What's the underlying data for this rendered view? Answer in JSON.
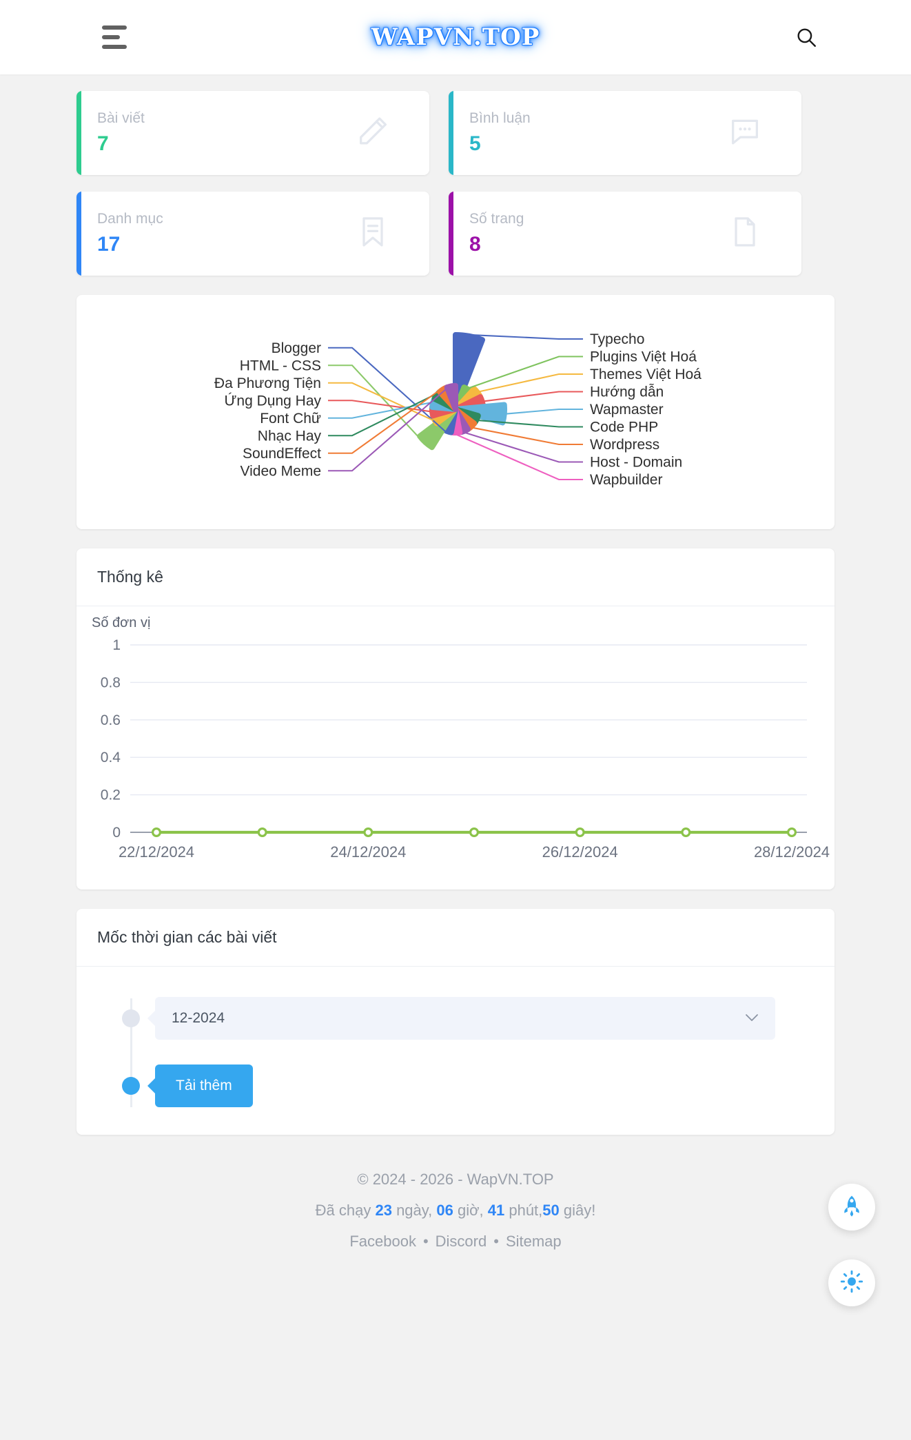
{
  "header": {
    "brand": "WAPVN.TOP",
    "menu_icon": "hamburger-icon",
    "search_icon": "search-icon"
  },
  "stats": [
    {
      "label": "Bài viết",
      "value": "7",
      "color": "#2ecc8f",
      "icon": "pencil-icon"
    },
    {
      "label": "Bình luận",
      "value": "5",
      "color": "#2ab7c8",
      "icon": "comment-icon"
    },
    {
      "label": "Danh mục",
      "value": "17",
      "color": "#2f86f6",
      "icon": "bookmark-icon"
    },
    {
      "label": "Số trang",
      "value": "8",
      "color": "#9c11a8",
      "icon": "page-icon"
    }
  ],
  "category_chart": {
    "type": "pie",
    "title": "",
    "labels": [
      "Typecho",
      "Plugins Việt Hoá",
      "Themes Việt Hoá",
      "Hướng dẫn",
      "Wapmaster",
      "Code PHP",
      "Wordpress",
      "Host - Domain",
      "Wapbuilder",
      "Blogger",
      "HTML - CSS",
      "Đa Phương Tiện",
      "Ứng Dụng Hay",
      "Font Chữ",
      "Nhạc Hay",
      "SoundEffect",
      "Video Meme"
    ],
    "values": [
      13,
      1,
      2,
      2,
      7,
      1,
      1,
      1,
      1,
      1,
      6,
      1,
      1,
      1,
      1,
      1,
      1
    ],
    "colors": [
      "#4a68c0",
      "#7fc35e",
      "#f5b940",
      "#e8595b",
      "#62b4dd",
      "#2f8a5f",
      "#f07b35",
      "#9b59b6",
      "#ee5fc0",
      "#4a68c0",
      "#8cc96a",
      "#f5b940",
      "#e8595b",
      "#62b4dd",
      "#2f8a5f",
      "#f07b35",
      "#9b59b6"
    ]
  },
  "stats_panel": {
    "title": "Thống kê"
  },
  "line_chart": {
    "type": "line",
    "ylabel": "Số đơn vị",
    "xlabel": "",
    "ylim": [
      0,
      1
    ],
    "yticks": [
      "1",
      "0.8",
      "0.6",
      "0.4",
      "0.2",
      "0"
    ],
    "xticks": [
      "22/12/2024",
      "24/12/2024",
      "26/12/2024",
      "28/12/2024"
    ],
    "x": [
      "22/12/2024",
      "23/12/2024",
      "24/12/2024",
      "25/12/2024",
      "26/12/2024",
      "27/12/2024",
      "28/12/2024"
    ],
    "values": [
      0,
      0,
      0,
      0,
      0,
      0,
      0
    ],
    "series_color": "#8bc34a",
    "grid": true,
    "legend": "none"
  },
  "timeline": {
    "title": "Mốc thời gian các bài viết",
    "entries": [
      {
        "label": "12-2024",
        "type": "select",
        "chevron": "chevron-down-icon"
      }
    ],
    "load_more": "Tải thêm"
  },
  "fabs": [
    {
      "icon": "rocket-icon",
      "color": "#35a7ef"
    },
    {
      "icon": "sun-icon",
      "color": "#35a7ef"
    }
  ],
  "footer": {
    "copyright": "© 2024 - 2026 - WapVN.TOP",
    "uptime": {
      "prefix": "Đã chạy ",
      "days": "23",
      "days_unit": " ngày, ",
      "hours": "06",
      "hours_unit": " giờ, ",
      "minutes": "41",
      "minutes_unit": " phút,",
      "seconds": "50",
      "seconds_unit": " giây!"
    },
    "links": [
      "Facebook",
      "Discord",
      "Sitemap"
    ],
    "separator": "•"
  }
}
